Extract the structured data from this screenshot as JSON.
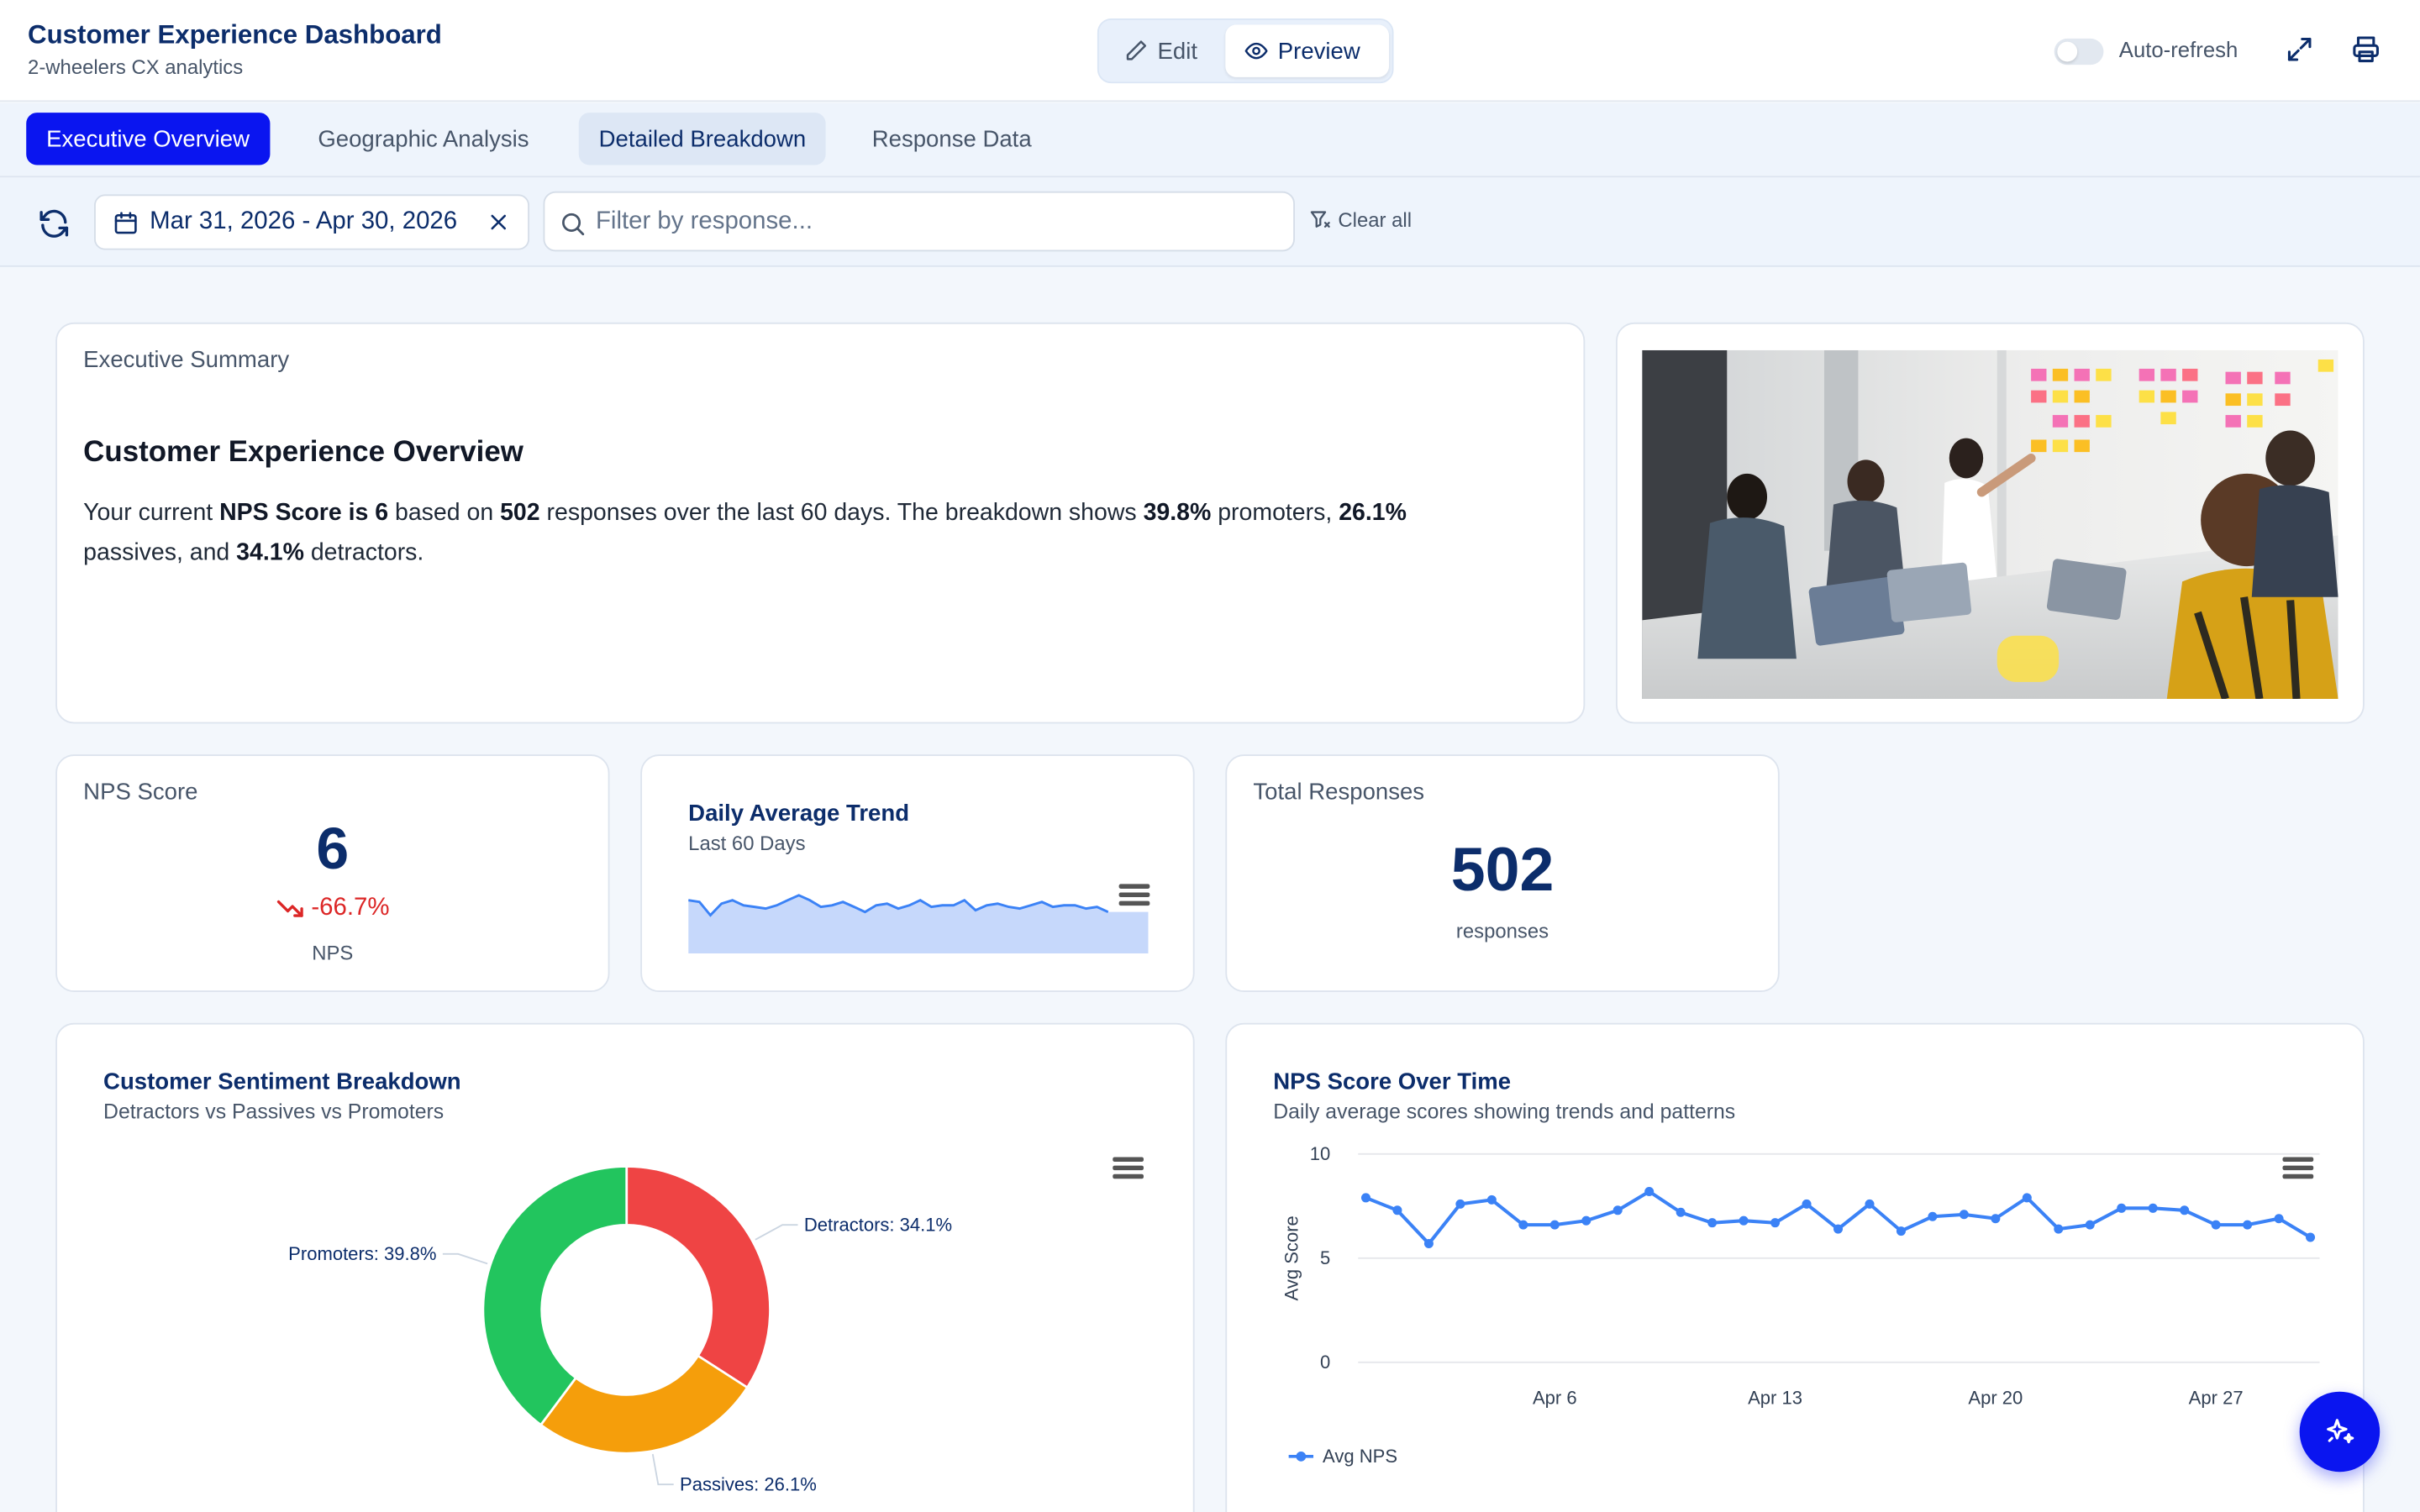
{
  "header": {
    "title": "Customer Experience Dashboard",
    "subtitle": "2-wheelers CX analytics",
    "edit_label": "Edit",
    "preview_label": "Preview",
    "auto_refresh_label": "Auto-refresh",
    "auto_refresh_on": false
  },
  "tabs": [
    {
      "label": "Executive Overview",
      "state": "active"
    },
    {
      "label": "Geographic Analysis",
      "state": "normal"
    },
    {
      "label": "Detailed Breakdown",
      "state": "hover"
    },
    {
      "label": "Response Data",
      "state": "normal"
    }
  ],
  "filters": {
    "date_range": "Mar 31, 2026 - Apr 30, 2026",
    "search_placeholder": "Filter by response...",
    "clear_label": "Clear all"
  },
  "summary": {
    "label": "Executive Summary",
    "heading": "Customer Experience Overview",
    "p1": "Your current ",
    "b1": "NPS Score is 6",
    "p2": " based on ",
    "b2": "502",
    "p3": " responses over the last 60 days. The breakdown shows ",
    "b3": "39.8%",
    "p4": " promoters, ",
    "b4": "26.1%",
    "p5": " passives, and ",
    "b5": "34.1%",
    "p6": " detractors."
  },
  "kpi_nps": {
    "label": "NPS Score",
    "value": "6",
    "change": "-66.7%",
    "unit": "NPS"
  },
  "kpi_trend": {
    "title": "Daily Average Trend",
    "subtitle": "Last 60 Days"
  },
  "kpi_responses": {
    "label": "Total Responses",
    "value": "502",
    "unit": "responses"
  },
  "sentiment": {
    "title": "Customer Sentiment Breakdown",
    "subtitle": "Detractors vs Passives vs Promoters"
  },
  "nps_time": {
    "title": "NPS Score Over Time",
    "subtitle": "Daily average scores showing trends and patterns"
  },
  "colors": {
    "accent": "#0a15f0",
    "navy": "#0c2d6b",
    "detractors": "#ef4444",
    "passives": "#f59e0b",
    "promoters": "#22c55e",
    "line": "#3b82f6"
  },
  "chart_data": [
    {
      "type": "area",
      "title": "Daily Average Trend",
      "subtitle": "Last 60 Days",
      "values": [
        7.9,
        7.8,
        7.0,
        7.7,
        7.9,
        7.6,
        7.5,
        7.4,
        7.6,
        7.9,
        8.2,
        7.9,
        7.5,
        7.6,
        7.8,
        7.5,
        7.2,
        7.6,
        7.7,
        7.4,
        7.6,
        7.9,
        7.5,
        7.6,
        7.6,
        7.9,
        7.3,
        7.6,
        7.7,
        7.5,
        7.4,
        7.6,
        7.8,
        7.5,
        7.6,
        7.6,
        7.4,
        7.5,
        7.2
      ]
    },
    {
      "type": "pie",
      "title": "Customer Sentiment Breakdown",
      "subtitle": "Detractors vs Passives vs Promoters",
      "categories": [
        "Detractors",
        "Passives",
        "Promoters"
      ],
      "values": [
        34.1,
        26.1,
        39.8
      ],
      "labels": [
        "Detractors: 34.1%",
        "Passives: 26.1%",
        "Promoters: 39.8%"
      ]
    },
    {
      "type": "line",
      "title": "NPS Score Over Time",
      "subtitle": "Daily average scores showing trends and patterns",
      "ylabel": "Avg Score",
      "ylim": [
        0,
        10
      ],
      "yticks": [
        "0",
        "5",
        "10"
      ],
      "xticks": [
        "Apr 6",
        "Apr 13",
        "Apr 20",
        "Apr 27"
      ],
      "grid": true,
      "legend_position": "bottom-left",
      "series": [
        {
          "name": "Avg NPS",
          "values": [
            7.9,
            7.3,
            5.7,
            7.6,
            7.8,
            6.6,
            6.6,
            6.8,
            7.3,
            8.2,
            7.2,
            6.7,
            6.8,
            6.7,
            7.6,
            6.4,
            7.6,
            6.3,
            7.0,
            7.1,
            6.9,
            7.9,
            6.4,
            6.6,
            7.4,
            7.4,
            7.3,
            6.6,
            6.6,
            6.9,
            6.0
          ]
        }
      ]
    }
  ]
}
